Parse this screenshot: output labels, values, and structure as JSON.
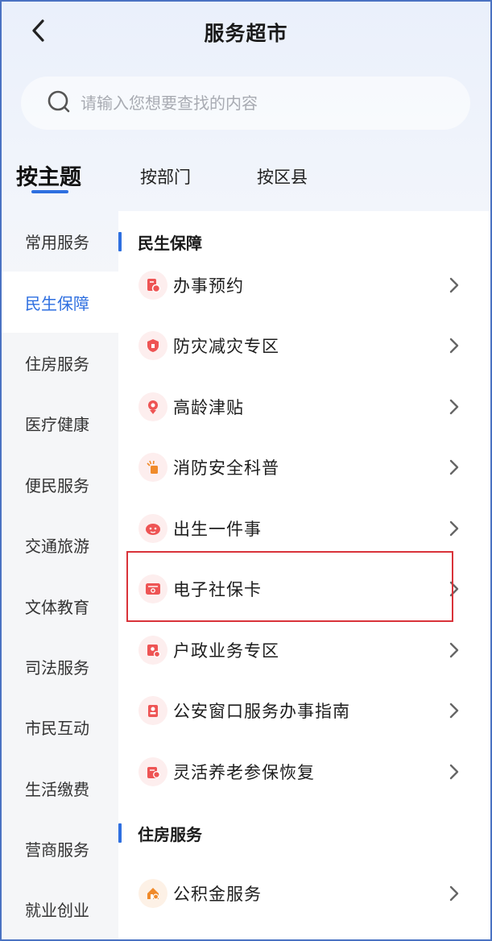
{
  "header": {
    "title": "服务超市",
    "back_icon": "chevron-left-icon"
  },
  "search": {
    "placeholder": "请输入您想要查找的内容",
    "value": ""
  },
  "tabs": [
    {
      "label": "按主题",
      "active": true
    },
    {
      "label": "按部门",
      "active": false
    },
    {
      "label": "按区县",
      "active": false
    }
  ],
  "sidebar": {
    "items": [
      {
        "label": "常用服务",
        "active": false
      },
      {
        "label": "民生保障",
        "active": true
      },
      {
        "label": "住房服务",
        "active": false
      },
      {
        "label": "医疗健康",
        "active": false
      },
      {
        "label": "便民服务",
        "active": false
      },
      {
        "label": "交通旅游",
        "active": false
      },
      {
        "label": "文体教育",
        "active": false
      },
      {
        "label": "司法服务",
        "active": false
      },
      {
        "label": "市民互动",
        "active": false
      },
      {
        "label": "生活缴费",
        "active": false
      },
      {
        "label": "营商服务",
        "active": false
      },
      {
        "label": "就业创业",
        "active": false
      }
    ]
  },
  "sections": [
    {
      "title": "民生保障",
      "items": [
        {
          "label": "办事预约",
          "icon": "appointment-icon"
        },
        {
          "label": "防灾减灾专区",
          "icon": "shield-icon"
        },
        {
          "label": "高龄津贴",
          "icon": "elderly-icon"
        },
        {
          "label": "消防安全科普",
          "icon": "fire-safety-icon"
        },
        {
          "label": "出生一件事",
          "icon": "baby-icon"
        },
        {
          "label": "电子社保卡",
          "icon": "card-icon"
        },
        {
          "label": "户政业务专区",
          "icon": "household-icon"
        },
        {
          "label": "公安窗口服务办事指南",
          "icon": "police-icon"
        },
        {
          "label": "灵活养老参保恢复",
          "icon": "pension-icon"
        }
      ]
    },
    {
      "title": "住房服务",
      "items": [
        {
          "label": "公积金服务",
          "icon": "housing-fund-icon"
        }
      ]
    }
  ],
  "colors": {
    "accent": "#2e6fe0",
    "highlight": "#d9333a",
    "icon_red": "#ee5454",
    "icon_orange": "#f08a2a"
  }
}
